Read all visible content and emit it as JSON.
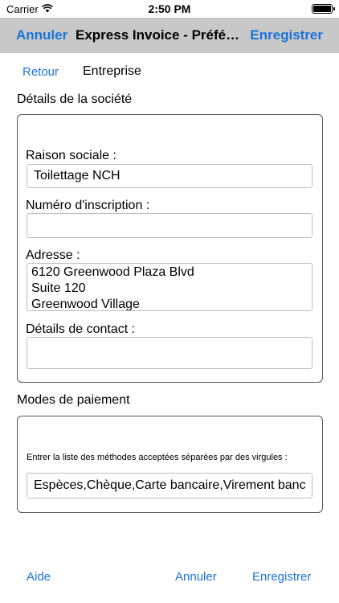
{
  "status_bar": {
    "carrier": "Carrier",
    "time": "2:50 PM",
    "wifi_icon": "wifi-icon",
    "battery_icon": "battery-icon"
  },
  "nav_bar": {
    "cancel_label": "Annuler",
    "title": "Express Invoice - Préférences",
    "save_label": "Enregistrer",
    "background_color": "#c8c8c8",
    "accent_color": "#1a73d9"
  },
  "sub_nav": {
    "back_label": "Retour",
    "title": "Entreprise"
  },
  "company_section": {
    "heading": "Détails de la société",
    "fields": {
      "company_name": {
        "label": "Raison sociale :",
        "value": "Toilettage NCH"
      },
      "registration_number": {
        "label": "Numéro d'inscription :",
        "value": ""
      },
      "address": {
        "label": "Adresse :",
        "value": "6120 Greenwood Plaza Blvd\nSuite 120\nGreenwood Village"
      },
      "contact_details": {
        "label": "Détails de contact :",
        "value": ""
      }
    }
  },
  "payment_section": {
    "heading": "Modes de paiement",
    "hint": "Entrer la liste des méthodes acceptées séparées par des virgules :",
    "value": "Espèces,Chèque,Carte bancaire,Virement bancaire"
  },
  "bottom_bar": {
    "help_label": "Aide",
    "cancel_label": "Annuler",
    "save_label": "Enregistrer"
  }
}
